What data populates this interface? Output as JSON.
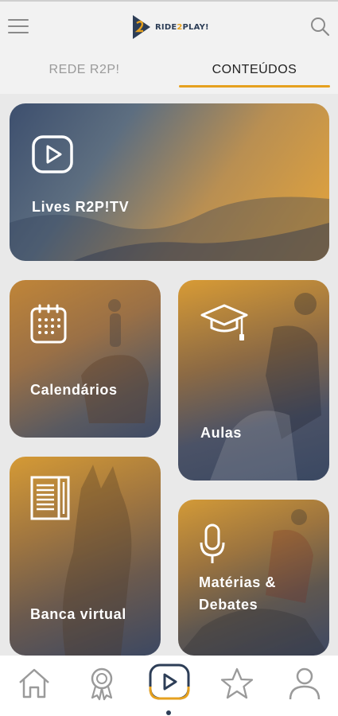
{
  "header": {
    "logo_text_a": "RIDE",
    "logo_text_b": "2",
    "logo_text_c": "PLAY!",
    "menu_icon": "hamburger-menu-icon",
    "search_icon": "search-icon"
  },
  "tabs": [
    {
      "label": "REDE R2P!",
      "active": false
    },
    {
      "label": "CONTEÚDOS",
      "active": true
    }
  ],
  "cards": {
    "lives": {
      "label": "Lives R2P!TV",
      "icon": "play-icon"
    },
    "calendarios": {
      "label": "Calendários",
      "icon": "calendar-icon"
    },
    "aulas": {
      "label": "Aulas",
      "icon": "graduation-cap-icon"
    },
    "banca": {
      "label": "Banca virtual",
      "icon": "newspaper-icon"
    },
    "materias": {
      "label_line1": "Matérias &",
      "label_line2": "Debates",
      "icon": "microphone-icon"
    }
  },
  "bottom_nav": [
    {
      "name": "home-icon",
      "active": false
    },
    {
      "name": "award-icon",
      "active": false
    },
    {
      "name": "play-icon",
      "active": true
    },
    {
      "name": "star-icon",
      "active": false
    },
    {
      "name": "profile-icon",
      "active": false
    }
  ],
  "colors": {
    "accent": "#e6a11f",
    "navy": "#2d3e57",
    "inactive_tab": "#9a9a9a",
    "nav_icon": "#9a9a9a"
  }
}
